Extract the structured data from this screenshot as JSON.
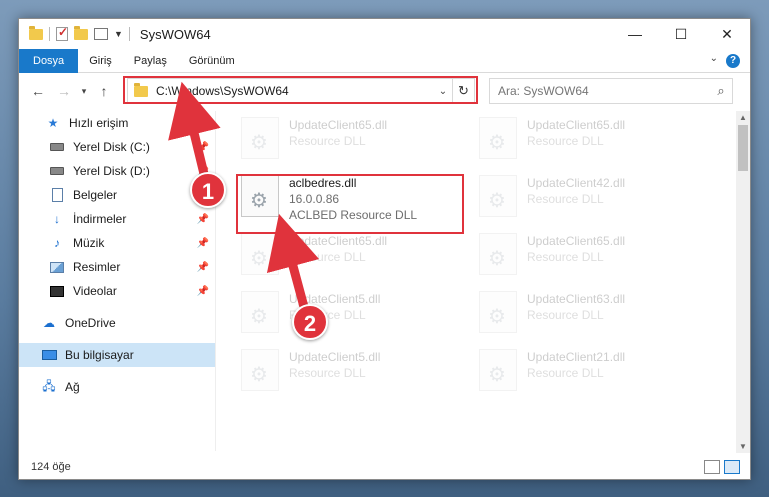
{
  "window": {
    "title": "SysWOW64",
    "controls": {
      "minimize": "—",
      "maximize": "☐",
      "close": "✕"
    }
  },
  "ribbon": {
    "tabs": [
      "Dosya",
      "Giriş",
      "Paylaş",
      "Görünüm"
    ],
    "active_tab": "Dosya",
    "help": "?"
  },
  "navbar": {
    "back": "←",
    "forward": "→",
    "recent": "▾",
    "up": "↑",
    "address": "C:\\Windows\\SysWOW64",
    "search_placeholder": "Ara: SysWOW64"
  },
  "sidebar": {
    "items": [
      {
        "label": "Hızlı erişim",
        "icon": "star-icon"
      },
      {
        "label": "Yerel Disk (C:)",
        "icon": "drive-icon",
        "pinned": true
      },
      {
        "label": "Yerel Disk (D:)",
        "icon": "drive-icon",
        "pinned": true
      },
      {
        "label": "Belgeler",
        "icon": "documents-icon",
        "pinned": true
      },
      {
        "label": "İndirmeler",
        "icon": "downloads-icon",
        "pinned": true
      },
      {
        "label": "Müzik",
        "icon": "music-icon",
        "pinned": true
      },
      {
        "label": "Resimler",
        "icon": "pictures-icon",
        "pinned": true
      },
      {
        "label": "Videolar",
        "icon": "videos-icon",
        "pinned": true
      },
      {
        "label": "OneDrive",
        "icon": "cloud-icon"
      },
      {
        "label": "Bu bilgisayar",
        "icon": "computer-icon",
        "selected": true
      },
      {
        "label": "Ağ",
        "icon": "network-icon"
      }
    ]
  },
  "files": {
    "highlighted": {
      "name": "aclbedres.dll",
      "version": "16.0.0.86",
      "description": "ACLBED Resource DLL"
    },
    "left_column": [
      {
        "name": "UpdateClient65.dll",
        "type": "Resource DLL"
      },
      {
        "name": "UpdateClient65.dll",
        "type": "Resource DLL"
      },
      {
        "name": "UpdateClient5.dll",
        "type": "Resource DLL"
      },
      {
        "name": "UpdateClient5.dll",
        "type": "Resource DLL"
      }
    ],
    "right_column": [
      {
        "name": "UpdateClient65.dll",
        "type": "Resource DLL"
      },
      {
        "name": "UpdateClient42.dll",
        "type": "Resource DLL"
      },
      {
        "name": "UpdateClient65.dll",
        "type": "Resource DLL"
      },
      {
        "name": "UpdateClient63.dll",
        "type": "Resource DLL"
      },
      {
        "name": "UpdateClient21.dll",
        "type": "Resource DLL"
      }
    ]
  },
  "status": {
    "item_count": "124 öğe"
  },
  "annotations": {
    "badge1": "1",
    "badge2": "2"
  },
  "colors": {
    "accent": "#1979ca",
    "highlight": "#e0333c"
  }
}
